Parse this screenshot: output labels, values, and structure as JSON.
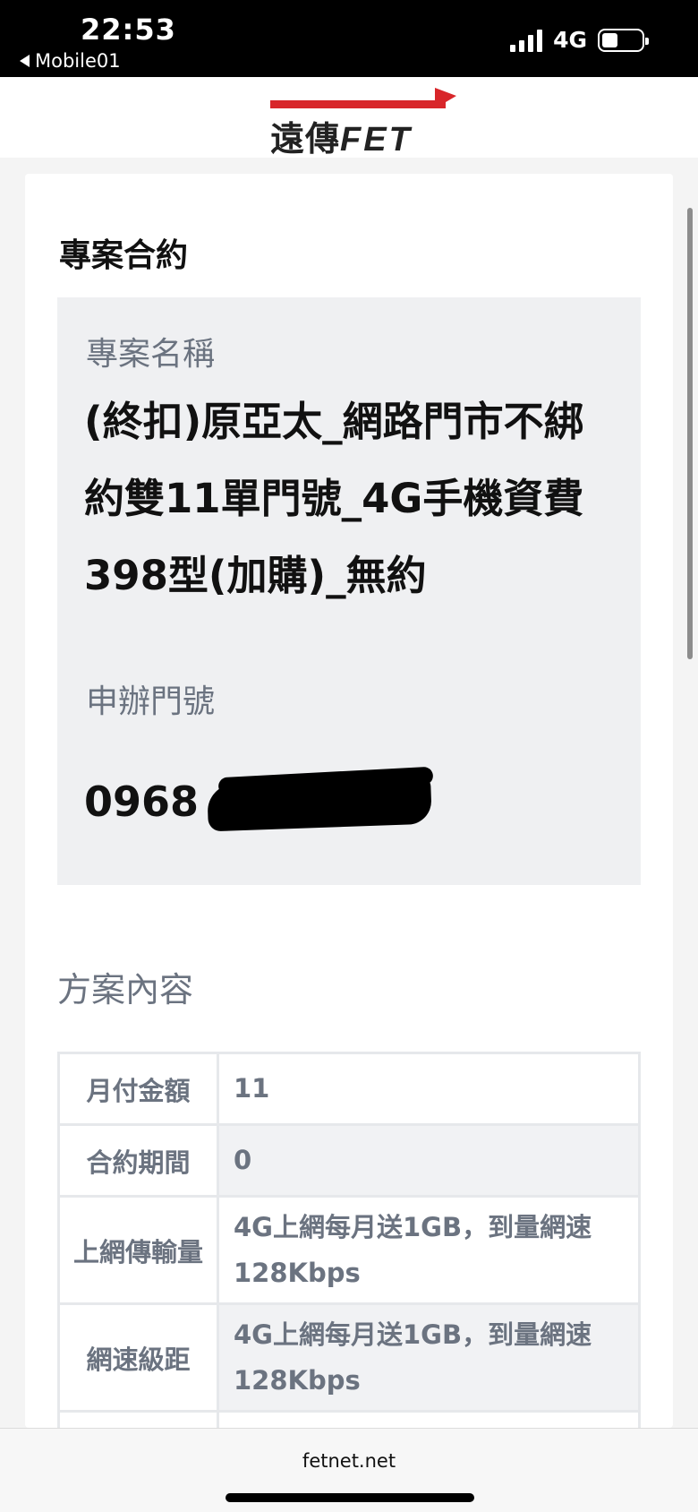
{
  "status_bar": {
    "time": "22:53",
    "back_label": "Mobile01",
    "network": "4G"
  },
  "header": {
    "logo_chinese": "遠傳",
    "logo_latin": "FET"
  },
  "contract": {
    "section_title": "專案合約",
    "plan_name_label": "專案名稱",
    "plan_name": "(終扣)原亞太_網路門市不綁約雙11單門號_4G手機資費398型(加購)_無約",
    "number_label": "申辦門號",
    "number_visible": "0968"
  },
  "plan_content": {
    "title": "方案內容",
    "rows": [
      {
        "key": "月付金額",
        "value": "11"
      },
      {
        "key": "合約期間",
        "value": "0"
      },
      {
        "key": "上網傳輸量",
        "value": "4G上網每月送1GB，到量網速128Kbps"
      },
      {
        "key": "網速級距",
        "value": "4G上網每月送1GB，到量網速128Kbps"
      }
    ]
  },
  "browser": {
    "url": "fetnet.net"
  }
}
